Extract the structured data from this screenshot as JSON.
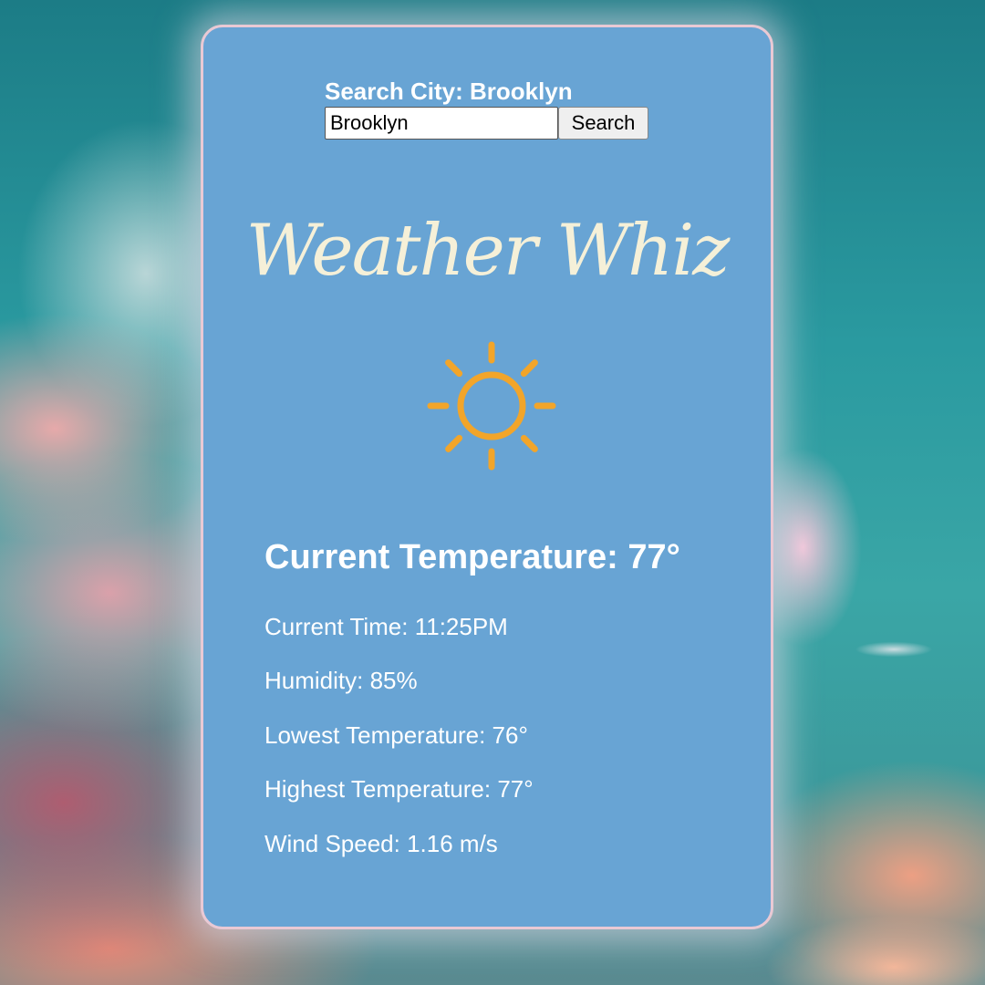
{
  "search": {
    "label": "Search City: Brooklyn",
    "input_value": "Brooklyn",
    "button_label": "Search"
  },
  "app": {
    "title": "Weather Whiz"
  },
  "weather": {
    "icon": "sun-icon",
    "current_temperature": "Current Temperature: 77°",
    "details": {
      "current_time": "Current Time: 11:25PM",
      "humidity": "Humidity: 85%",
      "lowest_temperature": "Lowest Temperature: 76°",
      "highest_temperature": "Highest Temperature: 77°",
      "wind_speed": "Wind Speed: 1.16 m/s"
    }
  },
  "colors": {
    "card_background": "#68a4d4",
    "card_border": "#e9c9d4",
    "title_color": "#f5f0d8",
    "sun_color": "#f2a52a"
  }
}
